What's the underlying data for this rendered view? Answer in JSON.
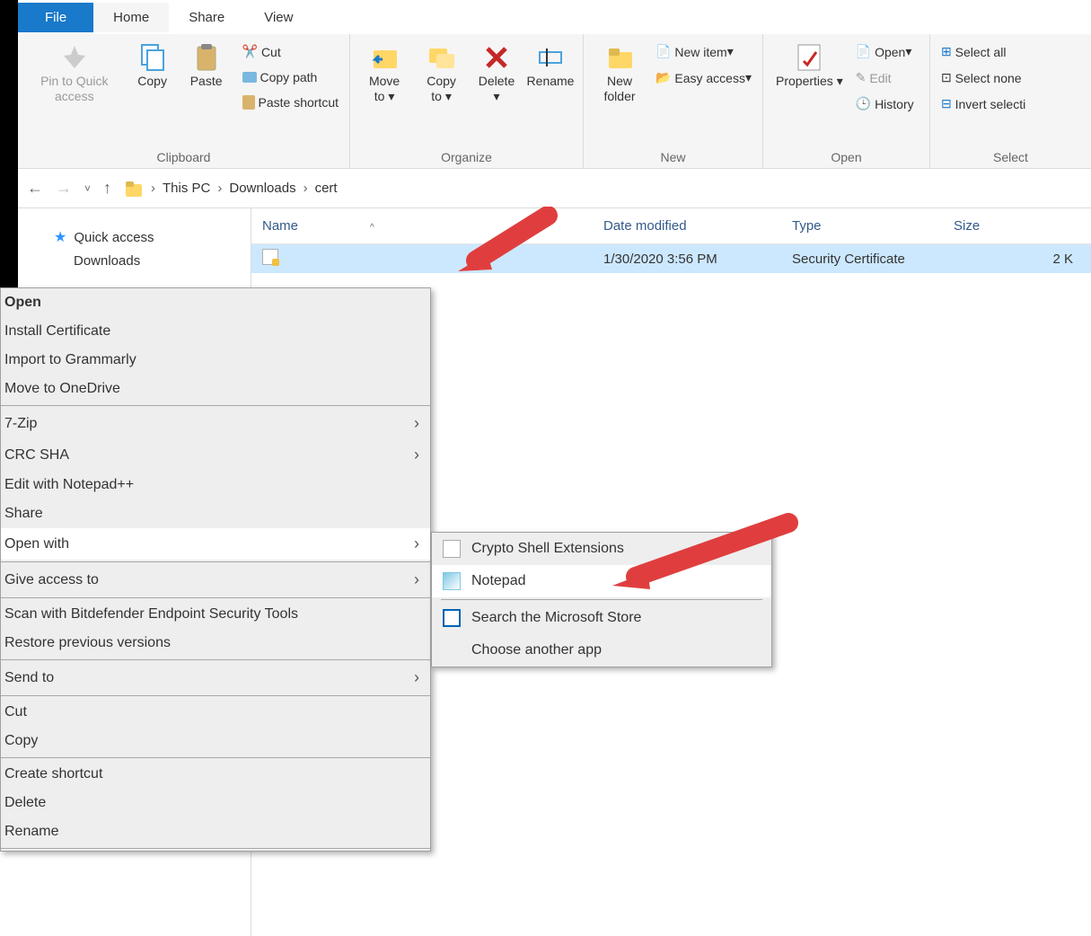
{
  "tabs": {
    "file": "File",
    "home": "Home",
    "share": "Share",
    "view": "View"
  },
  "ribbon": {
    "clipboard": {
      "label": "Clipboard",
      "pin": "Pin to Quick access",
      "copy": "Copy",
      "paste": "Paste",
      "cut": "Cut",
      "copy_path": "Copy path",
      "paste_shortcut": "Paste shortcut"
    },
    "organize": {
      "label": "Organize",
      "move_to": "Move to",
      "copy_to": "Copy to",
      "delete": "Delete",
      "rename": "Rename"
    },
    "new": {
      "label": "New",
      "new_folder": "New folder",
      "new_item": "New item",
      "easy_access": "Easy access"
    },
    "open": {
      "label": "Open",
      "properties": "Properties",
      "open": "Open",
      "edit": "Edit",
      "history": "History"
    },
    "select": {
      "label": "Select",
      "select_all": "Select all",
      "select_none": "Select none",
      "invert": "Invert selecti"
    }
  },
  "breadcrumb": {
    "items": [
      "This PC",
      "Downloads",
      "cert"
    ]
  },
  "sidebar": {
    "quick_access": "Quick access",
    "downloads": "Downloads"
  },
  "columns": {
    "name": "Name",
    "date": "Date modified",
    "type": "Type",
    "size": "Size"
  },
  "file": {
    "name": "",
    "date": "1/30/2020 3:56 PM",
    "type": "Security Certificate",
    "size": "2 K"
  },
  "context_menu": {
    "open": "Open",
    "install_cert": "Install Certificate",
    "import_grammarly": "Import to Grammarly",
    "move_onedrive": "Move to OneDrive",
    "seven_zip": "7-Zip",
    "crc_sha": "CRC SHA",
    "edit_npp": "Edit with Notepad++",
    "share": "Share",
    "open_with": "Open with",
    "give_access": "Give access to",
    "scan_bitdefender": "Scan with Bitdefender Endpoint Security Tools",
    "restore_versions": "Restore previous versions",
    "send_to": "Send to",
    "cut": "Cut",
    "copy": "Copy",
    "create_shortcut": "Create shortcut",
    "delete": "Delete",
    "rename": "Rename"
  },
  "submenu": {
    "crypto": "Crypto Shell Extensions",
    "notepad": "Notepad",
    "search_store": "Search the Microsoft Store",
    "choose_another": "Choose another app"
  }
}
